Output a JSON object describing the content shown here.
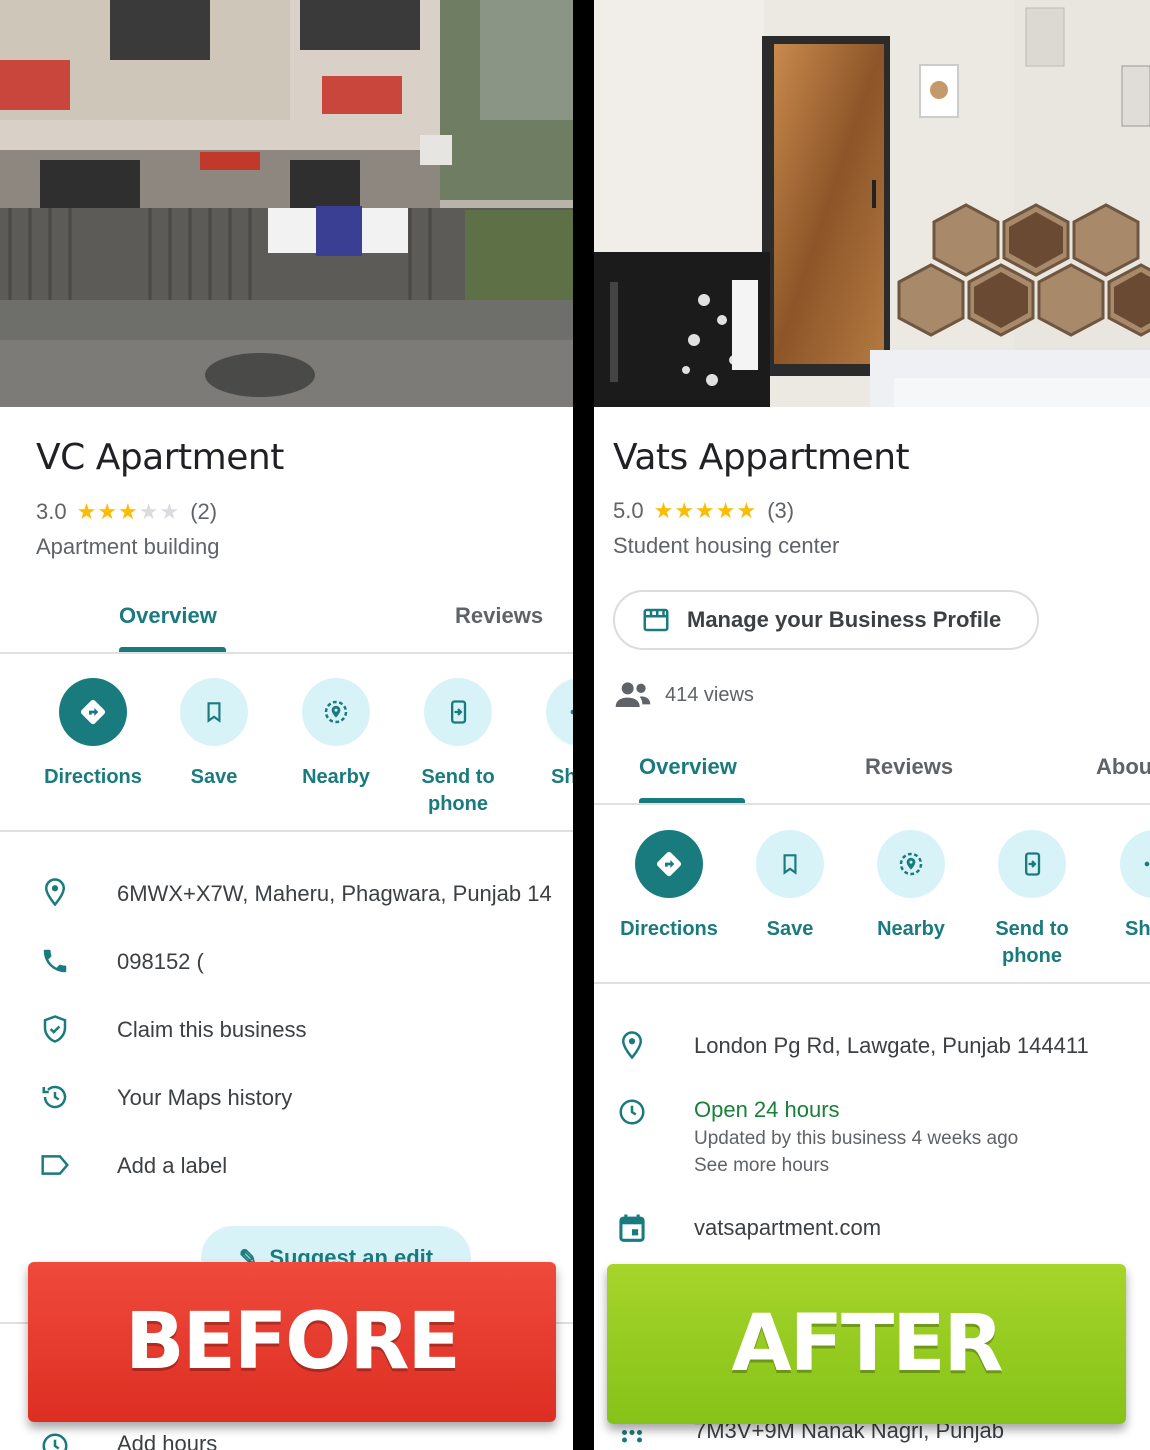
{
  "left": {
    "name": "VC Apartment",
    "rating": "3.0",
    "stars_filled": 3,
    "stars_total": 5,
    "review_count": "(2)",
    "category": "Apartment building",
    "tabs": [
      {
        "label": "Overview",
        "active": true
      },
      {
        "label": "Reviews",
        "active": false
      }
    ],
    "actions": [
      {
        "label": "Directions",
        "icon": "directions-icon",
        "primary": true
      },
      {
        "label": "Save",
        "icon": "bookmark-icon"
      },
      {
        "label": "Nearby",
        "icon": "nearby-icon"
      },
      {
        "label": "Send to\nphone",
        "icon": "send-to-phone-icon"
      },
      {
        "label": "Sh",
        "icon": "share-icon"
      }
    ],
    "info": [
      {
        "icon": "location-pin-icon",
        "text": "6MWX+X7W, Maheru, Phagwara, Punjab 14"
      },
      {
        "icon": "phone-icon",
        "text": "098152 ("
      },
      {
        "icon": "shield-check-icon",
        "text": "Claim this business"
      },
      {
        "icon": "history-icon",
        "text": "Your Maps history"
      },
      {
        "icon": "label-icon",
        "text": "Add a label"
      }
    ],
    "suggest_label": "Suggest an edit",
    "add_hours": "Add hours",
    "banner": "BEFORE"
  },
  "right": {
    "name": "Vats Appartment",
    "rating": "5.0",
    "stars_filled": 5,
    "stars_total": 5,
    "review_count": "(3)",
    "category": "Student housing center",
    "manage_label": "Manage your Business Profile",
    "views": "414 views",
    "tabs": [
      {
        "label": "Overview",
        "active": true
      },
      {
        "label": "Reviews",
        "active": false
      },
      {
        "label": "Abou",
        "active": false
      }
    ],
    "actions": [
      {
        "label": "Directions",
        "icon": "directions-icon",
        "primary": true
      },
      {
        "label": "Save",
        "icon": "bookmark-icon"
      },
      {
        "label": "Nearby",
        "icon": "nearby-icon"
      },
      {
        "label": "Send to\nphone",
        "icon": "send-to-phone-icon"
      },
      {
        "label": "Sh",
        "icon": "share-icon"
      }
    ],
    "address": "London Pg Rd, Lawgate, Punjab 144411",
    "hours_status": "Open 24 hours",
    "hours_updated": "Updated by this business 4 weeks ago",
    "hours_more": "See more hours",
    "website": "vatsapartment.com",
    "plus_code": "7M3V+9M Nanak Nagri, Punjab",
    "banner": "AFTER"
  },
  "colors": {
    "accent": "#1a7b7f",
    "star": "#fbbc04",
    "open": "#188038",
    "before": "#e53a2d",
    "after": "#92c91f"
  }
}
